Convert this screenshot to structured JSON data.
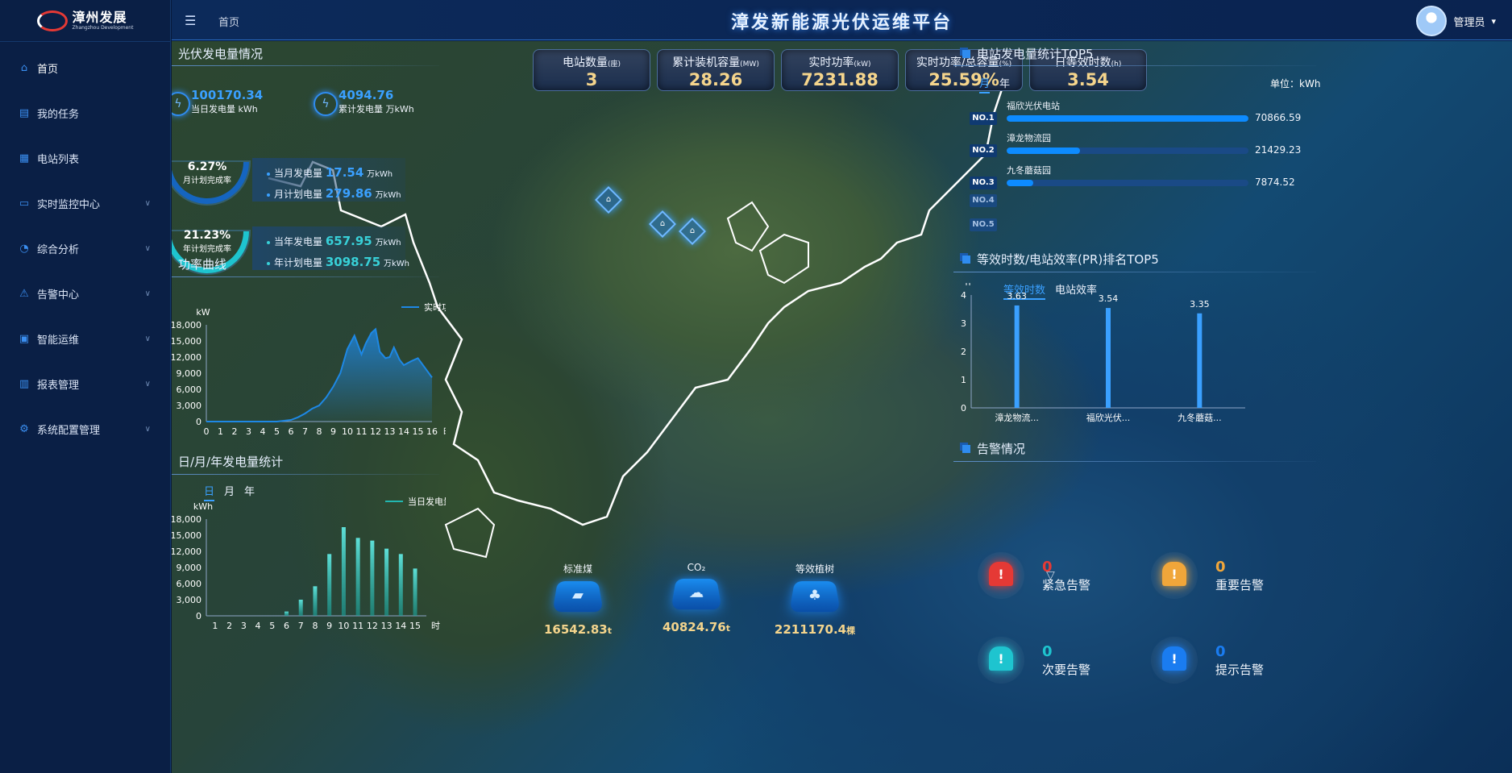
{
  "app": {
    "logo_cn": "漳州发展",
    "logo_en": "Zhangzhou Development",
    "title": "漳发新能源光伏运维平台",
    "breadcrumb": "首页",
    "user": "管理员",
    "user_caret": "▾"
  },
  "sidebar": {
    "items": [
      {
        "label": "首页",
        "icon": "home-icon",
        "glyph": "⌂",
        "active": true,
        "expandable": false
      },
      {
        "label": "我的任务",
        "icon": "task-icon",
        "glyph": "▤",
        "expandable": false
      },
      {
        "label": "电站列表",
        "icon": "list-icon",
        "glyph": "▦",
        "expandable": false
      },
      {
        "label": "实时监控中心",
        "icon": "monitor-icon",
        "glyph": "▭",
        "expandable": true
      },
      {
        "label": "综合分析",
        "icon": "analysis-icon",
        "glyph": "◔",
        "expandable": true
      },
      {
        "label": "告警中心",
        "icon": "alarm-icon",
        "glyph": "⚠",
        "expandable": true
      },
      {
        "label": "智能运维",
        "icon": "ops-icon",
        "glyph": "▣",
        "expandable": true
      },
      {
        "label": "报表管理",
        "icon": "report-icon",
        "glyph": "▥",
        "expandable": true
      },
      {
        "label": "系统配置管理",
        "icon": "settings-icon",
        "glyph": "⚙",
        "expandable": true
      }
    ]
  },
  "kpis": [
    {
      "label": "电站数量",
      "unit": "(座)",
      "value": "3"
    },
    {
      "label": "累计装机容量",
      "unit": "(MW)",
      "value": "28.26"
    },
    {
      "label": "实时功率",
      "unit": "(kW)",
      "value": "7231.88"
    },
    {
      "label": "实时功率/总容量",
      "unit": "(%)",
      "value": "25.59%"
    },
    {
      "label": "日等效时数",
      "unit": "(h)",
      "value": "3.54"
    }
  ],
  "pv": {
    "title": "光伏发电量情况",
    "daily_value": "100170.34",
    "daily_label": "当日发电量",
    "daily_unit": "kWh",
    "total_value": "4094.76",
    "total_label": "累计发电量",
    "total_unit": "万kWh",
    "month_rate": "6.27%",
    "month_rate_label": "月计划完成率",
    "year_rate": "21.23%",
    "year_rate_label": "年计划完成率",
    "month_gen_label": "当月发电量",
    "month_gen": "17.54",
    "month_plan_label": "月计划电量",
    "month_plan": "279.86",
    "year_gen_label": "当年发电量",
    "year_gen": "657.95",
    "year_plan_label": "年计划电量",
    "year_plan": "3098.75",
    "wan_unit": "万kWh"
  },
  "power_curve": {
    "title": "功率曲线",
    "chart_data": {
      "type": "area",
      "ylabel": "kW",
      "xlabel": "时",
      "legend": "实时功率",
      "legend_position": "top-right",
      "x": [
        0,
        1,
        2,
        3,
        4,
        5,
        6,
        6.5,
        7,
        7.5,
        8,
        8.5,
        9,
        9.5,
        10,
        10.5,
        11,
        11.3,
        11.7,
        12,
        12.3,
        12.7,
        13,
        13.3,
        13.7,
        14,
        14.5,
        15,
        15.5,
        16
      ],
      "y": [
        0,
        0,
        0,
        0,
        0,
        0,
        300,
        800,
        1500,
        2400,
        3000,
        4500,
        6500,
        9000,
        13500,
        16000,
        12500,
        14500,
        16500,
        17200,
        13000,
        11800,
        12000,
        13800,
        11500,
        10500,
        11200,
        11800,
        10000,
        8200
      ],
      "ylim": [
        0,
        18000
      ],
      "yticks": [
        "0",
        "3,000",
        "6,000",
        "9,000",
        "12,000",
        "15,000",
        "18,000"
      ],
      "xticks": [
        "0",
        "1",
        "2",
        "3",
        "4",
        "5",
        "6",
        "7",
        "8",
        "9",
        "10",
        "11",
        "12",
        "13",
        "14",
        "15",
        "16"
      ]
    }
  },
  "gen_stats": {
    "title": "日/月/年发电量统计",
    "tabs": [
      "日",
      "月",
      "年"
    ],
    "active_tab": "日",
    "chart_data": {
      "type": "bar",
      "ylabel": "kWh",
      "xlabel": "时",
      "legend": "当日发电量",
      "legend_position": "top-right",
      "categories": [
        "1",
        "2",
        "3",
        "4",
        "5",
        "6",
        "7",
        "8",
        "9",
        "10",
        "11",
        "12",
        "13",
        "14",
        "15"
      ],
      "values": [
        0,
        0,
        0,
        0,
        0,
        800,
        3000,
        5500,
        11500,
        16500,
        14500,
        14000,
        12500,
        11500,
        8800
      ],
      "ylim": [
        0,
        18000
      ],
      "yticks": [
        "0",
        "3,000",
        "6,000",
        "9,000",
        "12,000",
        "15,000",
        "18,000"
      ]
    }
  },
  "env": [
    {
      "label": "标准煤",
      "value": "16542.83",
      "unit": "t",
      "icon": "coal-icon",
      "glyph": "▰"
    },
    {
      "label": "CO₂",
      "value": "40824.76",
      "unit": "t",
      "icon": "co2-icon",
      "glyph": "☁"
    },
    {
      "label": "等效植树",
      "value": "2211170.4",
      "unit": "棵",
      "icon": "tree-icon",
      "glyph": "♣"
    }
  ],
  "top5": {
    "title": "电站发电量统计TOP5",
    "tabs": [
      "月",
      "年"
    ],
    "unit_label": "单位：kWh",
    "chart_data": {
      "type": "bar",
      "rows": [
        {
          "rank": "NO.1",
          "name": "福欣光伏电站",
          "value": 70866.59,
          "display": "70866.59"
        },
        {
          "rank": "NO.2",
          "name": "漳龙物流园",
          "value": 21429.23,
          "display": "21429.23"
        },
        {
          "rank": "NO.3",
          "name": "九冬蘑菇园",
          "value": 7874.52,
          "display": "7874.52"
        },
        {
          "rank": "NO.4",
          "name": "",
          "value": null,
          "display": ""
        },
        {
          "rank": "NO.5",
          "name": "",
          "value": null,
          "display": ""
        }
      ],
      "max": 70866.59
    }
  },
  "pr": {
    "title": "等效时数/电站效率(PR)排名TOP5",
    "tabs": [
      "等效时数",
      "电站效率"
    ],
    "active_tab": "等效时数",
    "chart_data": {
      "type": "bar",
      "ylabel": "h",
      "legend": "等效时数",
      "legend_position": "top-right",
      "categories": [
        "漳龙物流...",
        "福欣光伏...",
        "九冬蘑菇..."
      ],
      "values": [
        3.63,
        3.54,
        3.35
      ],
      "labels": [
        "3.63",
        "3.54",
        "3.35"
      ],
      "ylim": [
        0,
        4
      ],
      "yticks": [
        "0",
        "1",
        "2",
        "3",
        "4"
      ]
    }
  },
  "alarms": {
    "title": "告警情况",
    "items": [
      {
        "name": "紧急告警",
        "count": "0",
        "color": "#e53935",
        "glyph": "!"
      },
      {
        "name": "重要告警",
        "count": "0",
        "color": "#f0a63a",
        "glyph": "!"
      },
      {
        "name": "次要告警",
        "count": "0",
        "color": "#1ec4cf",
        "glyph": "!"
      },
      {
        "name": "提示告警",
        "count": "0",
        "color": "#1a7cf0",
        "glyph": "!"
      }
    ]
  },
  "colors": {
    "accent": "#3aa0ff",
    "gold": "#f5d58c",
    "teal": "#1ec4cf"
  }
}
